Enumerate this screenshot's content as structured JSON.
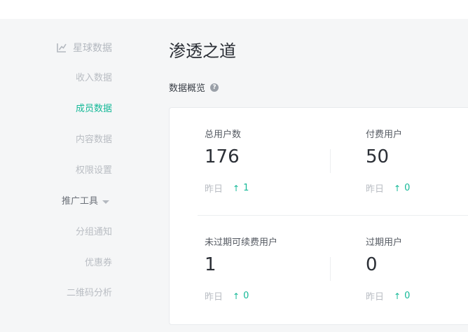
{
  "sidebar": {
    "section_title": "星球数据",
    "items": [
      {
        "label": "收入数据",
        "active": false
      },
      {
        "label": "成员数据",
        "active": true
      },
      {
        "label": "内容数据",
        "active": false
      },
      {
        "label": "权限设置",
        "active": false
      }
    ],
    "group_label": "推广工具",
    "group_items": [
      {
        "label": "分组通知"
      },
      {
        "label": "优惠券"
      },
      {
        "label": "二维码分析"
      }
    ]
  },
  "main": {
    "page_title": "渗透之道",
    "section_title": "数据概览",
    "help_glyph": "?",
    "stats": [
      {
        "label": "总用户数",
        "value": "176",
        "compare_label": "昨日",
        "change": "1"
      },
      {
        "label": "付费用户",
        "value": "50",
        "compare_label": "昨日",
        "change": "0"
      },
      {
        "label": "未过期可续费用户",
        "value": "1",
        "compare_label": "昨日",
        "change": "0"
      },
      {
        "label": "过期用户",
        "value": "0",
        "compare_label": "昨日",
        "change": "0"
      }
    ]
  },
  "colors": {
    "accent": "#16b998",
    "background": "#f5f6f7",
    "muted_text": "#b9bdc3",
    "dark_text": "#2b2f36"
  },
  "icons": {
    "section": "chart-line-icon",
    "help": "question-circle-icon",
    "caret": "caret-down-icon",
    "trend": "arrow-up-icon"
  }
}
